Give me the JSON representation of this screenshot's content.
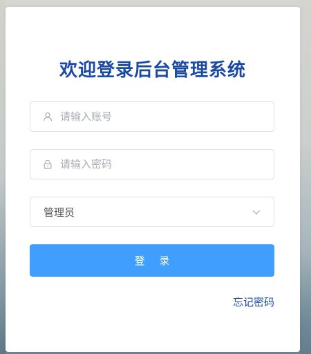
{
  "login": {
    "title": "欢迎登录后台管理系统",
    "username": {
      "placeholder": "请输入账号",
      "value": ""
    },
    "password": {
      "placeholder": "请输入密码",
      "value": ""
    },
    "role": {
      "selected": "管理员"
    },
    "submit_label": "登 录",
    "forgot_password_label": "忘记密码"
  },
  "colors": {
    "title": "#1a4aa3",
    "button_bg": "#409eff",
    "link": "#1a4aa3",
    "border": "#dcdfe6",
    "placeholder": "#a8abb2"
  },
  "icons": {
    "username_field": "user-icon",
    "password_field": "lock-icon",
    "role_select": "chevron-down-icon"
  }
}
